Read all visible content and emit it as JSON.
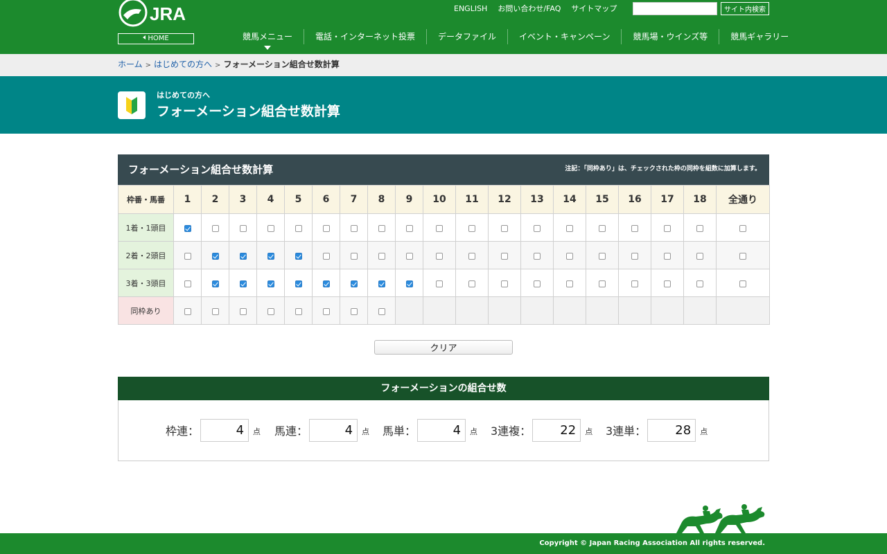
{
  "header": {
    "logo_text": "JRA",
    "home_label": "HOME",
    "top_links": [
      "ENGLISH",
      "お問い合わせ/FAQ",
      "サイトマップ"
    ],
    "search": {
      "value": "",
      "button_label": "サイト内検索"
    },
    "nav": [
      "競馬メニュー",
      "電話・インターネット投票",
      "データファイル",
      "イベント・キャンペーン",
      "競馬場・ウインズ等",
      "競馬ギャラリー"
    ]
  },
  "breadcrumb": {
    "items": [
      "ホーム",
      "はじめての方へ"
    ],
    "separator": ">",
    "current": "フォーメーション組合せ数計算"
  },
  "title": {
    "sub": "はじめての方へ",
    "main": "フォーメーション組合せ数計算"
  },
  "calculator": {
    "title": "フォーメーション組合せ数計算",
    "note": "注記：「同枠あり」は、チェックされた枠の同枠を組数に加算します。",
    "header_label": "枠番・馬番",
    "columns": [
      "1",
      "2",
      "3",
      "4",
      "5",
      "6",
      "7",
      "8",
      "9",
      "10",
      "11",
      "12",
      "13",
      "14",
      "15",
      "16",
      "17",
      "18",
      "全通り"
    ],
    "rows": [
      {
        "label": "1着・1頭目",
        "checked": [
          true,
          false,
          false,
          false,
          false,
          false,
          false,
          false,
          false,
          false,
          false,
          false,
          false,
          false,
          false,
          false,
          false,
          false,
          false
        ]
      },
      {
        "label": "2着・2頭目",
        "checked": [
          false,
          true,
          true,
          true,
          true,
          false,
          false,
          false,
          false,
          false,
          false,
          false,
          false,
          false,
          false,
          false,
          false,
          false,
          false
        ]
      },
      {
        "label": "3着・3頭目",
        "checked": [
          false,
          true,
          true,
          true,
          true,
          true,
          true,
          true,
          true,
          false,
          false,
          false,
          false,
          false,
          false,
          false,
          false,
          false,
          false
        ]
      },
      {
        "label": "同枠あり",
        "checked": [
          false,
          false,
          false,
          false,
          false,
          false,
          false,
          false
        ],
        "available_columns": 8
      }
    ],
    "clear_label": "クリア"
  },
  "results": {
    "title": "フォーメーションの組合せ数",
    "unit": "点",
    "items": [
      {
        "label": "枠連：",
        "value": "4"
      },
      {
        "label": "馬連：",
        "value": "4"
      },
      {
        "label": "馬単：",
        "value": "4"
      },
      {
        "label": "3連複：",
        "value": "22"
      },
      {
        "label": "3連単：",
        "value": "28"
      }
    ]
  },
  "footer": {
    "copyright": "Copyright © Japan Racing Association All rights reserved."
  },
  "colors": {
    "brand_green": "#1c8a2d",
    "title_teal": "#008587",
    "table_header_dark": "#374a50",
    "result_header_green": "#175229",
    "checkbox_blue": "#2a8bde"
  }
}
